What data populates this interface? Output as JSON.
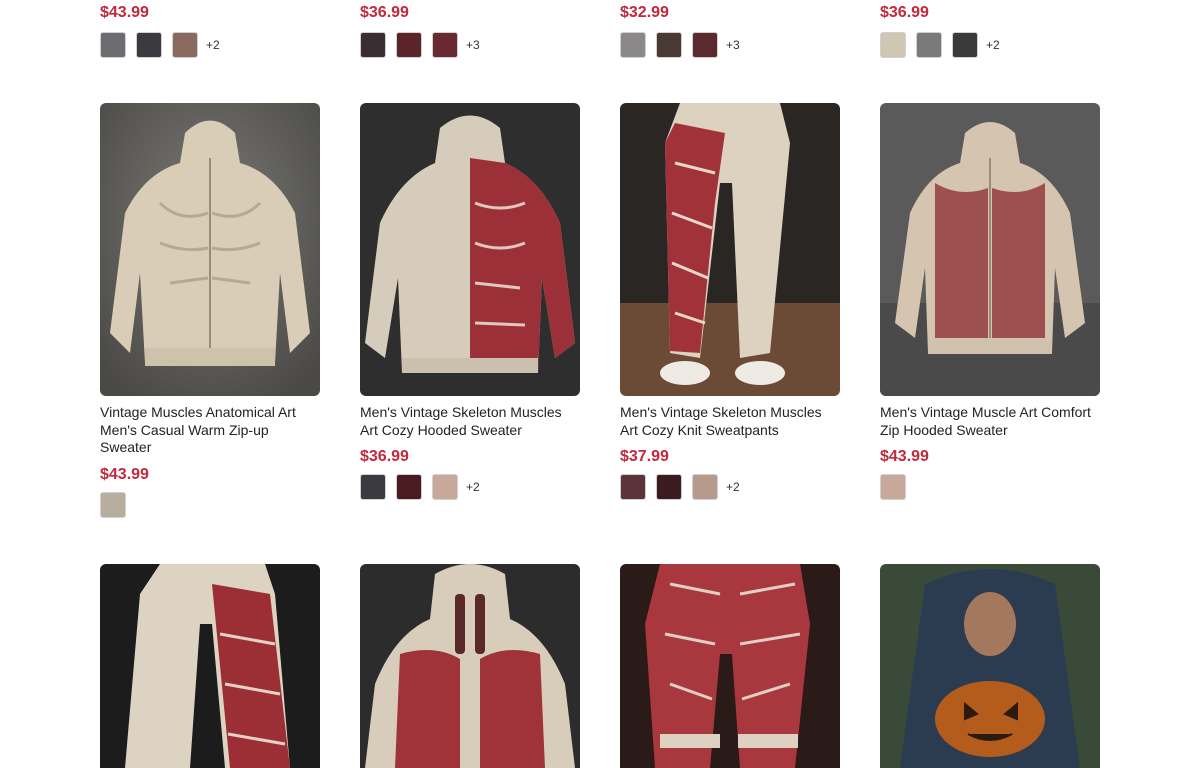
{
  "top_row": [
    {
      "price": "$43.99",
      "swatches": [
        "#6e6c70",
        "#3a3a3f",
        "#8a6a5e"
      ],
      "more": "+2"
    },
    {
      "price": "$36.99",
      "swatches": [
        "#3a2e33",
        "#5a2428",
        "#6a2830"
      ],
      "more": "+3"
    },
    {
      "price": "$32.99",
      "swatches": [
        "#8a8888",
        "#4a3a36",
        "#5a2a2e"
      ],
      "more": "+3"
    },
    {
      "price": "$36.99",
      "swatches": [
        "#cfc6b4",
        "#7a7a7c",
        "#3a3a3a"
      ],
      "more": "+2"
    }
  ],
  "row2": [
    {
      "title": "Vintage Muscles Anatomical Art Men's Casual Warm Zip-up Sweater",
      "price": "$43.99",
      "swatches": [
        "#b8ae9e"
      ],
      "more": ""
    },
    {
      "title": "Men's Vintage Skeleton Muscles Art Cozy Hooded Sweater",
      "price": "$36.99",
      "swatches": [
        "#3a3a40",
        "#4a1c22",
        "#c9a79a"
      ],
      "more": "+2"
    },
    {
      "title": "Men's Vintage Skeleton Muscles Art Cozy Knit Sweatpants",
      "price": "$37.99",
      "swatches": [
        "#5a3438",
        "#3a1c20",
        "#b8998e"
      ],
      "more": "+2"
    },
    {
      "title": "Men's Vintage Muscle Art Comfort Zip Hooded Sweater",
      "price": "$43.99",
      "swatches": [
        "#c8a89a"
      ],
      "more": ""
    }
  ]
}
